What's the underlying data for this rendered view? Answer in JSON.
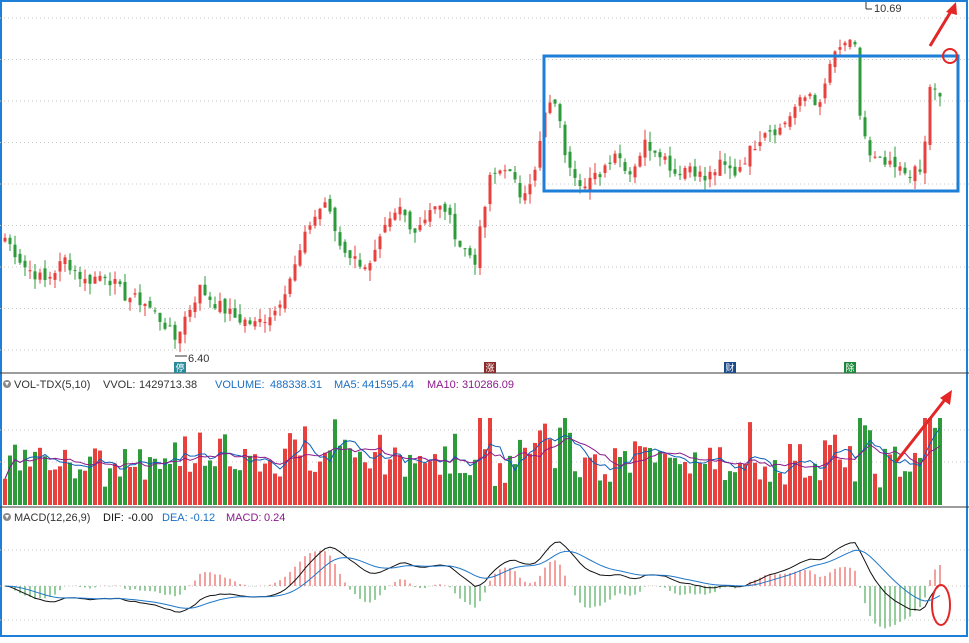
{
  "colors": {
    "up": "#e8403c",
    "down": "#2e9b3a",
    "frame": "#1e7fd8",
    "annotation": "#e32626",
    "grid": "#c8c8c8",
    "vol_ma5": "#0a5fb8",
    "vol_ma10": "#8b1a8b",
    "macd_dif": "#111111",
    "macd_dea": "#1f77c9",
    "macd_hist": "#8b1a8b"
  },
  "price_panel": {
    "high_label": "10.69",
    "low_label": "6.40",
    "event_markers": [
      {
        "label": "停",
        "color": "#2a8a9a",
        "index": 35
      },
      {
        "label": "涨",
        "color": "#8b2a2a",
        "index": 97
      },
      {
        "label": "财",
        "color": "#1a4a8a",
        "index": 145
      },
      {
        "label": "除",
        "color": "#1a8a3a",
        "index": 169
      }
    ]
  },
  "volume_panel": {
    "indicator_name": "VOL-TDX(5,10)",
    "vvol_label": "VVOL:",
    "vvol_value": "1429713.38",
    "volume_label": "VOLUME:",
    "volume_value": "488338.31",
    "ma5_label": "MA5:",
    "ma5_value": "441595.44",
    "ma10_label": "MA10:",
    "ma10_value": "310286.09"
  },
  "macd_panel": {
    "indicator_name": "MACD(12,26,9)",
    "dif_label": "DIF:",
    "dif_value": "-0.00",
    "dea_label": "DEA:",
    "dea_value": "-0.12",
    "macd_label": "MACD:",
    "macd_value": "0.24"
  },
  "chart_data": {
    "type": "candlestick",
    "anchors": [
      [
        0,
        7.8
      ],
      [
        4,
        7.4
      ],
      [
        8,
        7.2
      ],
      [
        12,
        7.5
      ],
      [
        16,
        7.2
      ],
      [
        20,
        7.3
      ],
      [
        24,
        7.0
      ],
      [
        28,
        6.9
      ],
      [
        32,
        6.6
      ],
      [
        34,
        6.4
      ],
      [
        36,
        6.7
      ],
      [
        39,
        7.1
      ],
      [
        42,
        6.9
      ],
      [
        46,
        6.7
      ],
      [
        50,
        6.6
      ],
      [
        54,
        6.8
      ],
      [
        58,
        7.4
      ],
      [
        61,
        8.0
      ],
      [
        64,
        8.3
      ],
      [
        67,
        7.7
      ],
      [
        70,
        7.5
      ],
      [
        73,
        7.4
      ],
      [
        76,
        7.9
      ],
      [
        79,
        8.2
      ],
      [
        82,
        7.9
      ],
      [
        85,
        8.2
      ],
      [
        88,
        8.2
      ],
      [
        91,
        7.7
      ],
      [
        94,
        7.5
      ],
      [
        97,
        8.6
      ],
      [
        100,
        8.8
      ],
      [
        103,
        8.4
      ],
      [
        106,
        8.7
      ],
      [
        108,
        9.5
      ],
      [
        110,
        9.7
      ],
      [
        112,
        9.0
      ],
      [
        114,
        8.7
      ],
      [
        116,
        8.5
      ],
      [
        119,
        8.7
      ],
      [
        122,
        9.0
      ],
      [
        125,
        8.7
      ],
      [
        128,
        9.1
      ],
      [
        131,
        9.0
      ],
      [
        134,
        8.7
      ],
      [
        137,
        8.8
      ],
      [
        140,
        8.6
      ],
      [
        143,
        8.8
      ],
      [
        146,
        8.7
      ],
      [
        149,
        9.0
      ],
      [
        152,
        9.3
      ],
      [
        155,
        9.3
      ],
      [
        158,
        9.6
      ],
      [
        161,
        9.8
      ],
      [
        163,
        9.6
      ],
      [
        165,
        10.2
      ],
      [
        168,
        10.5
      ],
      [
        170,
        10.4
      ],
      [
        171,
        9.5
      ],
      [
        173,
        8.9
      ],
      [
        176,
        8.8
      ],
      [
        180,
        8.7
      ],
      [
        183,
        8.7
      ],
      [
        184,
        9.1
      ],
      [
        185,
        9.9
      ],
      [
        187,
        9.7
      ]
    ],
    "n_candles": 188,
    "seed": 7,
    "price_range": [
      6.0,
      11.0
    ],
    "annotations": [
      {
        "type": "range-box",
        "from_index": 106,
        "to_index": 188,
        "from_price": 8.65,
        "to_price": 10.2
      }
    ]
  }
}
